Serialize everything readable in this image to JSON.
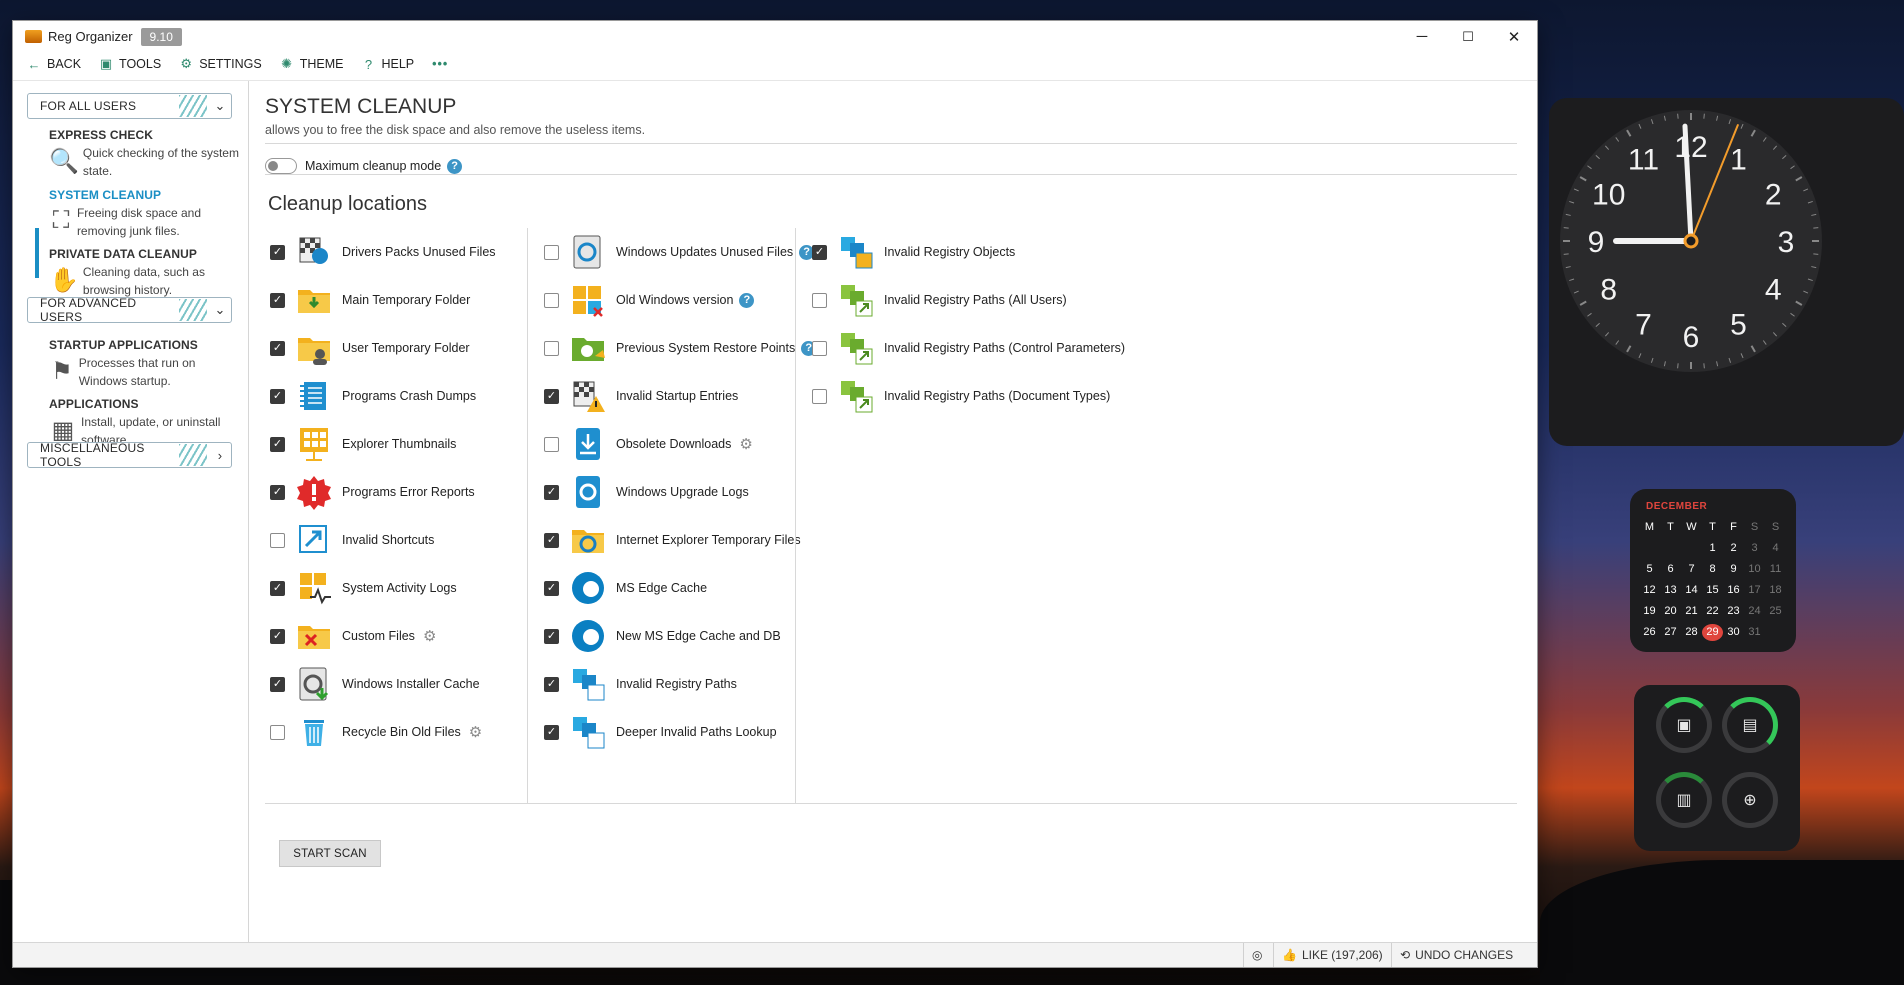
{
  "window": {
    "app_title": "Reg Organizer",
    "version": "9.10",
    "controls": {
      "minimize": "─",
      "maximize": "☐",
      "close": "✕"
    }
  },
  "menubar": [
    {
      "label": "BACK",
      "icon": "back-arrow-icon",
      "glyph": "←"
    },
    {
      "label": "TOOLS",
      "icon": "toolbox-icon",
      "glyph": "▣"
    },
    {
      "label": "SETTINGS",
      "icon": "gear-icon",
      "glyph": "⚙"
    },
    {
      "label": "THEME",
      "icon": "bulb-icon",
      "glyph": "✺"
    },
    {
      "label": "HELP",
      "icon": "help-circle-icon",
      "glyph": "?"
    },
    {
      "label": "•••",
      "icon": "more-icon",
      "glyph": ""
    }
  ],
  "sidebar": {
    "group1": "FOR ALL USERS",
    "group2": "FOR ADVANCED USERS",
    "group3": "MISCELLANEOUS TOOLS",
    "items": [
      {
        "title": "EXPRESS CHECK",
        "desc": "Quick checking of the system state.",
        "icon": "magnifier-check-icon"
      },
      {
        "title": "SYSTEM CLEANUP",
        "desc": "Freeing disk space and removing junk files.",
        "icon": "cleanup-icon",
        "active": true
      },
      {
        "title": "PRIVATE DATA CLEANUP",
        "desc": "Cleaning data, such as browsing history.",
        "icon": "private-cleanup-icon"
      },
      {
        "title": "STARTUP APPLICATIONS",
        "desc": "Processes that run on Windows startup.",
        "icon": "startup-flag-icon"
      },
      {
        "title": "APPLICATIONS",
        "desc": "Install, update, or uninstall software.",
        "icon": "applications-icon"
      }
    ]
  },
  "main": {
    "title": "SYSTEM CLEANUP",
    "subtitle": "allows you to free the disk space and also remove the useless items.",
    "toggle_label": "Maximum cleanup mode",
    "section_title": "Cleanup locations",
    "start_scan": "START SCAN",
    "columns": [
      [
        {
          "label": "Drivers Packs Unused Files",
          "checked": true,
          "icon": "driver-gear-icon"
        },
        {
          "label": "Main Temporary Folder",
          "checked": true,
          "icon": "folder-download-icon"
        },
        {
          "label": "User Temporary Folder",
          "checked": true,
          "icon": "folder-user-icon"
        },
        {
          "label": "Programs Crash Dumps",
          "checked": true,
          "icon": "crash-dump-icon"
        },
        {
          "label": "Explorer Thumbnails",
          "checked": true,
          "icon": "thumbnails-icon"
        },
        {
          "label": "Programs Error Reports",
          "checked": true,
          "icon": "error-report-icon"
        },
        {
          "label": "Invalid Shortcuts",
          "checked": false,
          "icon": "shortcut-icon"
        },
        {
          "label": "System Activity Logs",
          "checked": true,
          "icon": "activity-log-icon"
        },
        {
          "label": "Custom Files",
          "checked": true,
          "icon": "custom-files-icon",
          "gear": true
        },
        {
          "label": "Windows Installer Cache",
          "checked": true,
          "icon": "installer-cache-icon"
        },
        {
          "label": "Recycle Bin Old Files",
          "checked": false,
          "icon": "recycle-bin-icon",
          "gear": true
        }
      ],
      [
        {
          "label": "Windows Updates Unused Files",
          "checked": false,
          "icon": "windows-update-icon",
          "help": true
        },
        {
          "label": "Old Windows version",
          "checked": false,
          "icon": "old-windows-icon",
          "help": true
        },
        {
          "label": "Previous System Restore Points",
          "checked": false,
          "icon": "restore-point-icon",
          "help": true
        },
        {
          "label": "Invalid Startup Entries",
          "checked": true,
          "icon": "startup-warning-icon"
        },
        {
          "label": "Obsolete Downloads",
          "checked": false,
          "icon": "downloads-icon",
          "gear": true
        },
        {
          "label": "Windows Upgrade Logs",
          "checked": true,
          "icon": "upgrade-log-icon"
        },
        {
          "label": "Internet Explorer Temporary Files",
          "checked": true,
          "icon": "ie-folder-icon"
        },
        {
          "label": "MS Edge Cache",
          "checked": true,
          "icon": "edge-icon"
        },
        {
          "label": "New MS Edge Cache and DB",
          "checked": true,
          "icon": "edge-icon"
        },
        {
          "label": "Invalid Registry Paths",
          "checked": true,
          "icon": "registry-path-icon"
        },
        {
          "label": "Deeper Invalid Paths Lookup",
          "checked": true,
          "icon": "registry-path-icon"
        }
      ],
      [
        {
          "label": "Invalid Registry Objects",
          "checked": true,
          "icon": "registry-objects-icon"
        },
        {
          "label": "Invalid Registry Paths (All Users)",
          "checked": false,
          "icon": "registry-green-icon"
        },
        {
          "label": "Invalid Registry Paths (Control Parameters)",
          "checked": false,
          "icon": "registry-green-icon"
        },
        {
          "label": "Invalid Registry Paths (Document Types)",
          "checked": false,
          "icon": "registry-green-icon"
        }
      ]
    ]
  },
  "status": {
    "like": "LIKE (197,206)",
    "undo": "UNDO CHANGES"
  },
  "widgets": {
    "clock_numbers": [
      "12",
      "1",
      "2",
      "3",
      "4",
      "5",
      "6",
      "7",
      "8",
      "9",
      "10",
      "11"
    ],
    "calendar": {
      "month": "DECEMBER",
      "weekdays": [
        "M",
        "T",
        "W",
        "T",
        "F",
        "S",
        "S"
      ],
      "days": [
        "",
        "",
        "",
        "1",
        "2",
        "3",
        "4",
        "5",
        "6",
        "7",
        "8",
        "9",
        "10",
        "11",
        "12",
        "13",
        "14",
        "15",
        "16",
        "17",
        "18",
        "19",
        "20",
        "21",
        "22",
        "23",
        "24",
        "25",
        "26",
        "27",
        "28",
        "29",
        "30",
        "31"
      ],
      "today": "29"
    },
    "system": [
      "cpu-icon",
      "memory-icon",
      "disk-icon",
      "network-icon"
    ]
  },
  "colors": {
    "accent": "#1a8ec4",
    "teal": "#2f8a6e",
    "folder": "#f3b11e",
    "edge": "#0a7fc2",
    "registry_green": "#6aab2e"
  }
}
